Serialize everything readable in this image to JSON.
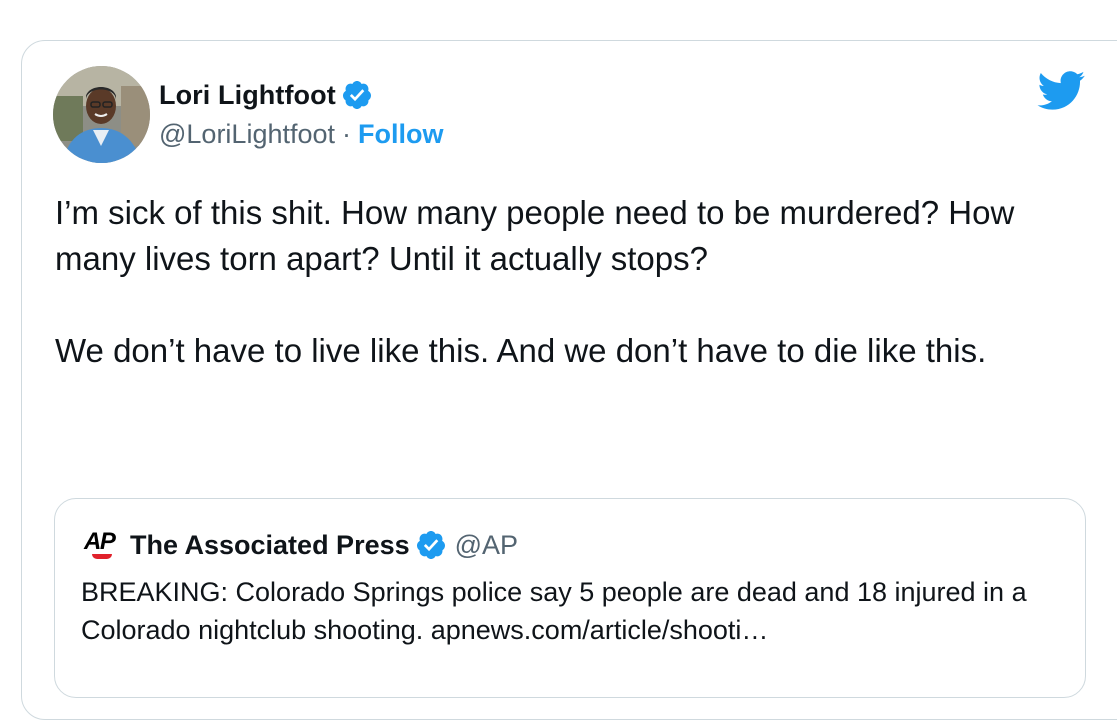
{
  "tweet": {
    "author_name": "Lori Lightfoot",
    "author_handle": "@LoriLightfoot",
    "separator": "·",
    "follow_label": "Follow",
    "paragraphs": [
      "I’m sick of this shit. How many people need to be murdered? How many lives torn apart? Until it actually stops?",
      "We don’t have to live like this. And we don’t have to die like this."
    ]
  },
  "quoted_tweet": {
    "logo_text": "AP",
    "author_name": "The Associated Press",
    "author_handle": "@AP",
    "text": "BREAKING: Colorado Springs police say 5 people are dead and 18 injured in a Colorado nightclub shooting. apnews.com/article/shooti…"
  },
  "icons": {
    "avatar": "avatar-photo",
    "verified": "verified-badge-icon",
    "brand": "twitter-bird-icon"
  },
  "colors": {
    "brand_blue": "#1d9bf0",
    "text_primary": "#0f1419",
    "text_secondary": "#536471",
    "border": "#cfd9de",
    "ap_red": "#e0212b"
  }
}
